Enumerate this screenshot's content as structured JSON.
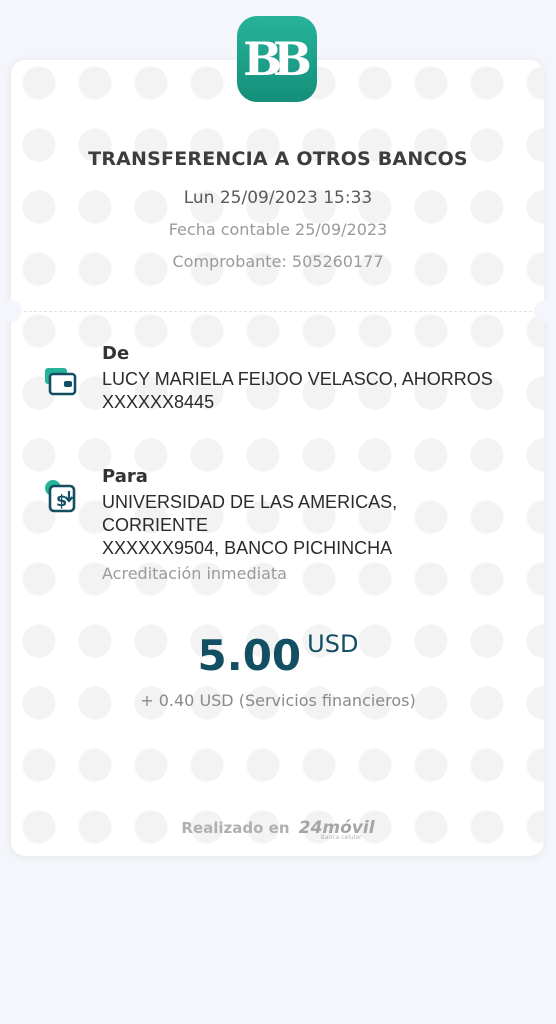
{
  "logo": {
    "text": "BB",
    "color": "#1fa88e"
  },
  "receipt": {
    "title": "TRANSFERENCIA A OTROS BANCOS",
    "date": "Lun 25/09/2023  15:33",
    "accounting_date": "Fecha contable 25/09/2023",
    "voucher": "Comprobante: 505260177"
  },
  "from": {
    "label": "De",
    "text": "LUCY MARIELA FEIJOO VELASCO, AHORROS\nXXXXXX8445",
    "icon": "wallet-icon"
  },
  "to": {
    "label": "Para",
    "text": "UNIVERSIDAD DE LAS AMERICAS,\nCORRIENTE\nXXXXXX9504, BANCO PICHINCHA",
    "note": "Acreditación inmediata",
    "icon": "money-transfer-icon"
  },
  "amount": {
    "value": "5.00",
    "currency": "USD",
    "fee": "+ 0.40 USD (Servicios financieros)",
    "color": "#124f63"
  },
  "footer": {
    "text": "Realizado en",
    "brand": "24móvil",
    "brand_sub": "Banca celular"
  }
}
